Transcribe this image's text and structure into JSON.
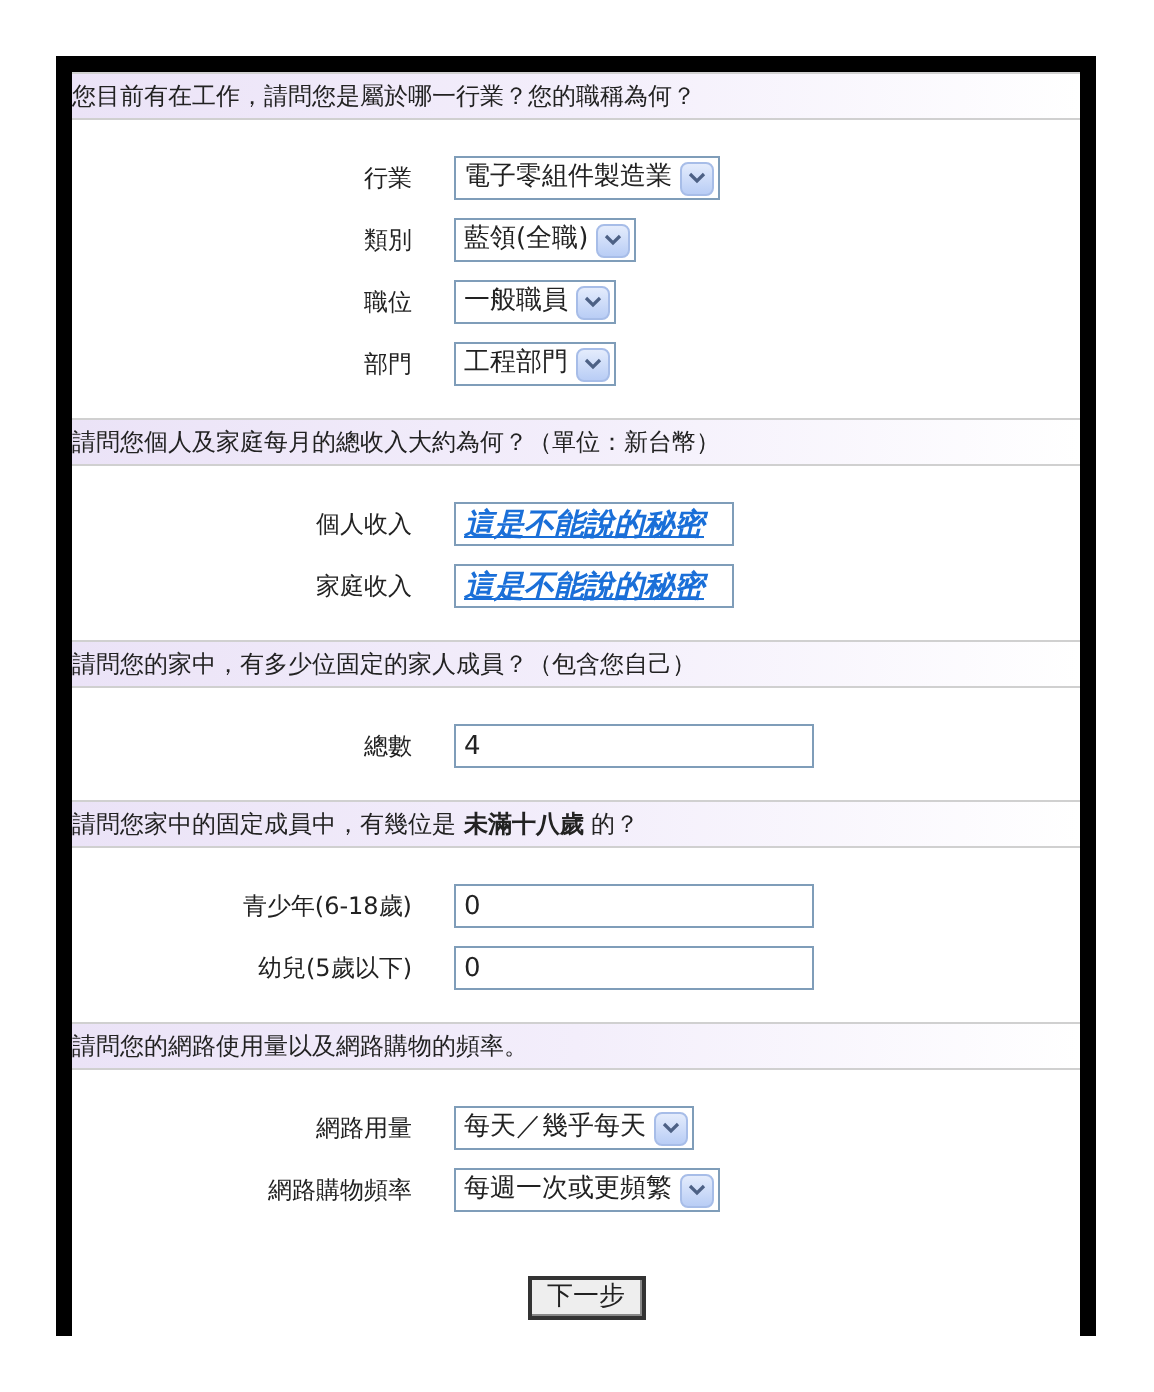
{
  "sections": [
    {
      "title": "您目前有在工作，請問您是屬於哪一行業？您的職稱為何？",
      "fields": [
        {
          "kind": "select",
          "label": "行業",
          "value": "電子零組件製造業"
        },
        {
          "kind": "select",
          "label": "類別",
          "value": "藍領(全職)"
        },
        {
          "kind": "select",
          "label": "職位",
          "value": "一般職員"
        },
        {
          "kind": "select",
          "label": "部門",
          "value": "工程部門"
        }
      ]
    },
    {
      "title": "請問您個人及家庭每月的總收入大約為何？（單位：新台幣）",
      "fields": [
        {
          "kind": "secret",
          "label": "個人收入",
          "value": "這是不能說的秘密"
        },
        {
          "kind": "secret",
          "label": "家庭收入",
          "value": "這是不能說的秘密"
        }
      ]
    },
    {
      "title": "請問您的家中，有多少位固定的家人成員？（包含您自己）",
      "fields": [
        {
          "kind": "text",
          "label": "總數",
          "value": "4"
        }
      ]
    },
    {
      "title": "請問您家中的固定成員中，有幾位是 **未滿十八歲** 的？",
      "fields": [
        {
          "kind": "text",
          "label": "青少年(6-18歲)",
          "value": "0"
        },
        {
          "kind": "text",
          "label": "幼兒(5歲以下)",
          "value": "0"
        }
      ]
    },
    {
      "title": "請問您的網路使用量以及網路購物的頻率。",
      "fields": [
        {
          "kind": "select",
          "label": "網路用量",
          "value": "每天／幾乎每天"
        },
        {
          "kind": "select",
          "label": "網路購物頻率",
          "value": "每週一次或更頻繁"
        }
      ]
    }
  ],
  "button": "下一步"
}
